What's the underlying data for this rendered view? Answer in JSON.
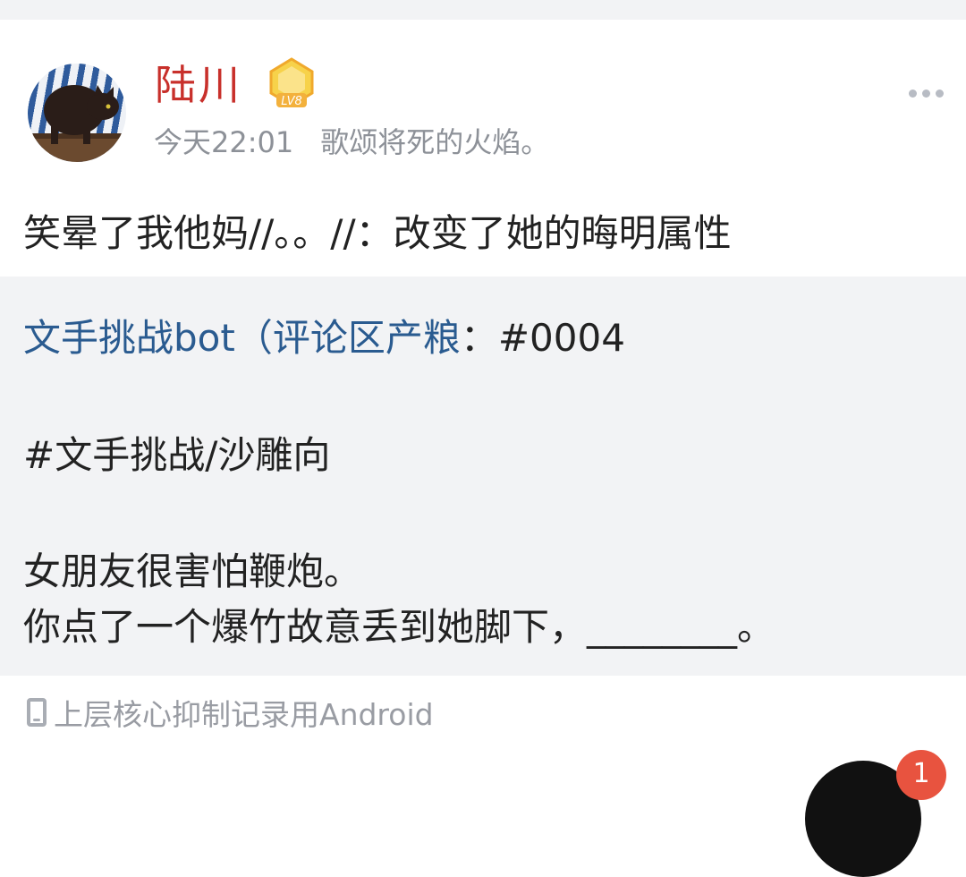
{
  "post": {
    "author": "陆川",
    "level_badge": "LV8",
    "time": "今天22:01",
    "source": "歌颂将死的火焰。",
    "text": "笑晕了我他妈//。。//：改变了她的晦明属性"
  },
  "quoted": {
    "author": "文手挑战bot（评论区产粮",
    "author_sep": "：",
    "id_text": "#0004",
    "tag_line": "#文手挑战/沙雕向",
    "line1": "女朋友很害怕鞭炮。",
    "line2": "你点了一个爆竹故意丢到她脚下，________。"
  },
  "footer": {
    "device": "上层核心抑制记录用Android"
  },
  "notifications": {
    "count": "1"
  },
  "colors": {
    "username": "#c8302b",
    "quote_author": "#2a5b90",
    "quote_bg": "#f2f3f5",
    "badge": "#e8533f"
  },
  "icons": [
    "avatar-image",
    "level-badge-icon",
    "more-icon",
    "phone-icon"
  ]
}
